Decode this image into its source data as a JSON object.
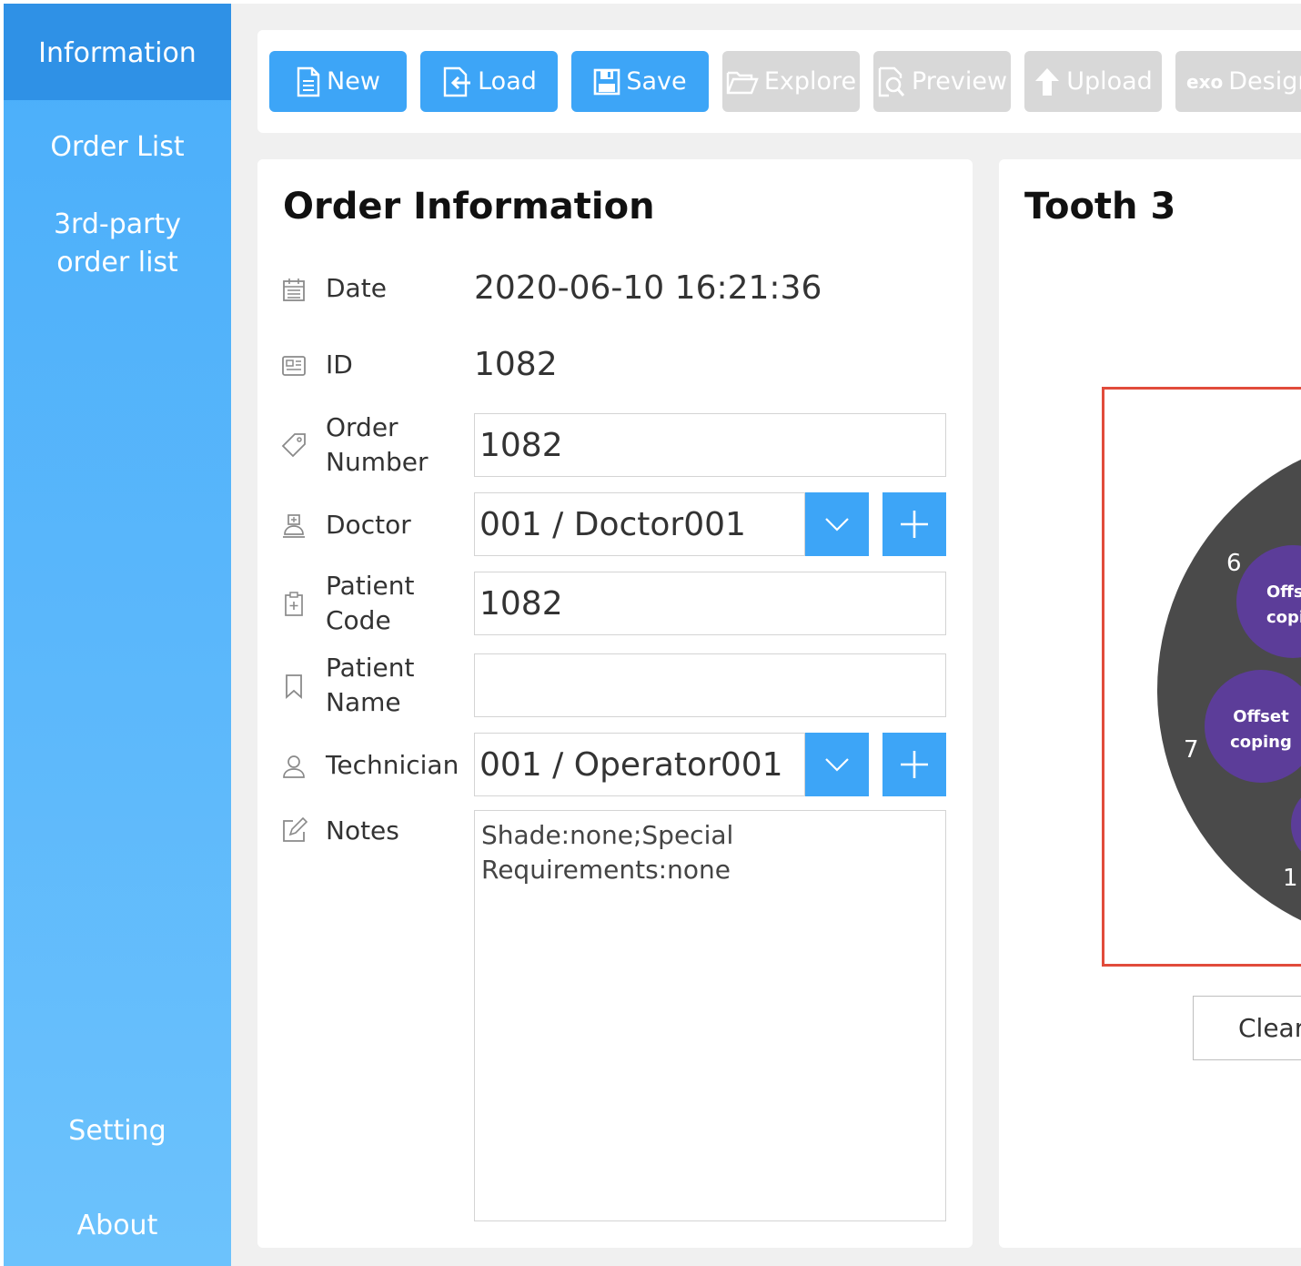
{
  "sidebar": {
    "items": [
      {
        "label": "Information"
      },
      {
        "label": "Order List"
      },
      {
        "label": "3rd-party\norder list"
      },
      {
        "label": "Setting"
      },
      {
        "label": "About"
      }
    ],
    "colors": {
      "active_bg": "#2f91e6",
      "bg": "#4aaefa"
    }
  },
  "toolbar": {
    "new_label": "New",
    "load_label": "Load",
    "save_label": "Save",
    "explore_label": "Explore",
    "preview_label": "Preview",
    "upload_label": "Upload",
    "exo_label": "exo",
    "design_label": "Design",
    "enabled_color": "#3da5f7",
    "disabled_color": "#d8d8d8"
  },
  "order": {
    "title": "Order Information",
    "date_label": "Date",
    "date_value": "2020-06-10 16:21:36",
    "id_label": "ID",
    "id_value": "1082",
    "order_number_label": "Order\nNumber",
    "order_number_value": "1082",
    "doctor_label": "Doctor",
    "doctor_value": "001 / Doctor001",
    "patient_code_label": "Patient\nCode",
    "patient_code_value": "1082",
    "patient_name_label": "Patient\nName",
    "patient_name_value": "",
    "technician_label": "Technician",
    "technician_value": "001 / Operator001",
    "notes_label": "Notes",
    "notes_value": "Shade:none;Special\nRequirements:none"
  },
  "tooth": {
    "title": "Tooth 3",
    "positions": [
      {
        "number": "6",
        "label": "Offs\ncopi"
      },
      {
        "number": "7",
        "label": "Offset\ncoping"
      },
      {
        "number": "1",
        "label": ""
      }
    ],
    "clear_label": "Clear",
    "frame_color": "#e14b3b",
    "disc_color": "#4a4a4a",
    "slot_color": "#5c3d99"
  }
}
